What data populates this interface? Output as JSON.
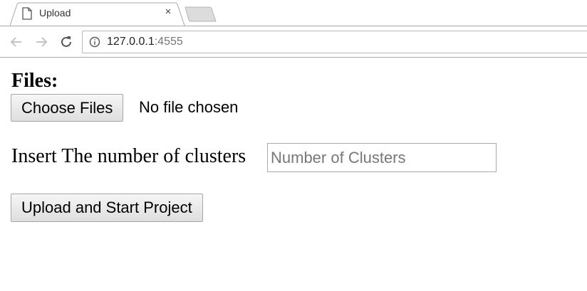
{
  "browser": {
    "tab": {
      "title": "Upload",
      "close_glyph": "×",
      "icon": "document-icon"
    },
    "address": {
      "host": "127.0.0.1",
      "port": ":4555"
    },
    "icons": {
      "back": "back-arrow-icon",
      "forward": "forward-arrow-icon",
      "reload": "reload-icon",
      "info": "info-icon"
    }
  },
  "page": {
    "files_heading": "Files:",
    "choose_files_label": "Choose Files",
    "no_file_text": "No file chosen",
    "clusters_label": "Insert The number of clusters",
    "clusters_input": {
      "value": "",
      "placeholder": "Number of Clusters"
    },
    "upload_button_label": "Upload and Start Project"
  }
}
